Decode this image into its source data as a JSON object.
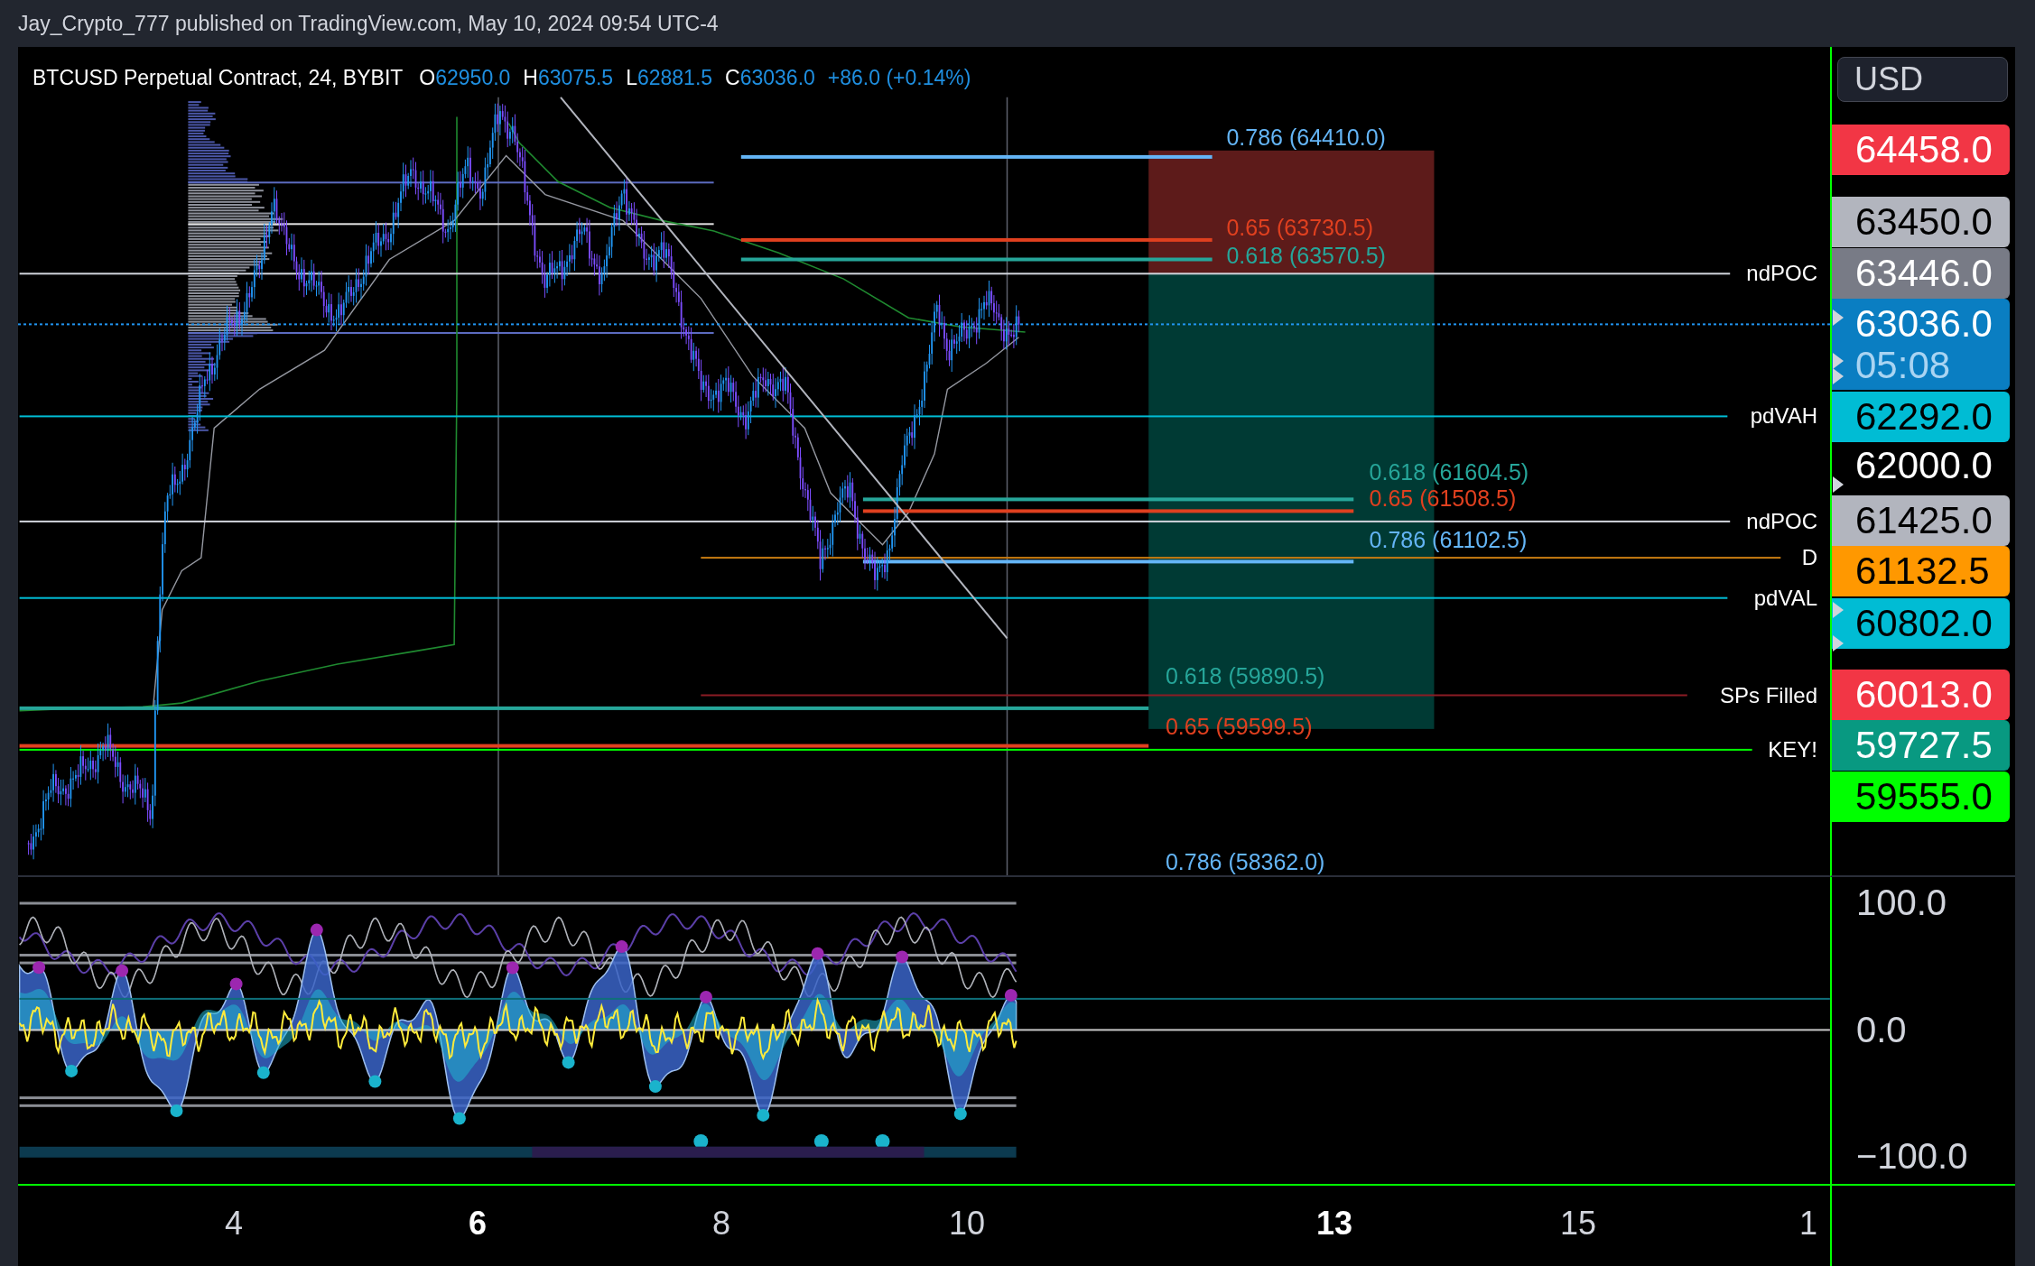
{
  "header": {
    "text": "Jay_Crypto_777 published on TradingView.com, May 10, 2024 09:54 UTC-4"
  },
  "legend": {
    "symbol": "BTCUSD Perpetual Contract, 24, BYBIT",
    "ohlc": [
      {
        "label": "O",
        "value": "62950.0"
      },
      {
        "label": "H",
        "value": "63075.5"
      },
      {
        "label": "L",
        "value": "62881.5"
      },
      {
        "label": "C",
        "value": "63036.0"
      }
    ],
    "change": "+86.0 (+0.14%)"
  },
  "levels": [
    {
      "label": "ndPOC",
      "color": "#d1d4dc"
    },
    {
      "label": "pdVAH",
      "color": "#00bcd4"
    },
    {
      "label": "ndPOC",
      "color": "#d1d4dc"
    },
    {
      "label": "D",
      "color": "#c77c12"
    },
    {
      "label": "pdVAL",
      "color": "#00bcd4"
    },
    {
      "label": "SPs Filled",
      "color": "#8b1c24"
    },
    {
      "label": "KEY!",
      "color": "#00ff00"
    }
  ],
  "fib_levels": [
    {
      "label": "0.786 (64410.0)",
      "color": "#64b5f6"
    },
    {
      "label": "0.65 (63730.5)",
      "color": "#e0401f"
    },
    {
      "label": "0.618 (63570.5)",
      "color": "#26a69a"
    },
    {
      "label": "0.618 (61604.5)",
      "color": "#26a69a"
    },
    {
      "label": "0.65 (61508.5)",
      "color": "#e0401f"
    },
    {
      "label": "0.786 (61102.5)",
      "color": "#64b5f6"
    },
    {
      "label": "0.618 (59890.5)",
      "color": "#26a69a"
    },
    {
      "label": "0.65 (59599.5)",
      "color": "#e0401f"
    },
    {
      "label": "0.786 (58362.0)",
      "color": "#64b5f6"
    }
  ],
  "price_axis": {
    "currency_button": "USD",
    "labels": [
      {
        "kind": "tag",
        "text": "64458.0",
        "color": "#f23645"
      },
      {
        "kind": "tag",
        "text": "63450.0",
        "color": "#b2b5be"
      },
      {
        "kind": "tag",
        "text": "63446.0",
        "color": "#787b86"
      },
      {
        "kind": "tag",
        "text": "63036.0",
        "countdown": "05:08",
        "color": "#0a7ec2"
      },
      {
        "kind": "tag",
        "text": "62292.0",
        "color": "#00bcd4"
      },
      {
        "kind": "tick",
        "text": "62000.0"
      },
      {
        "kind": "tag",
        "text": "61425.0",
        "color": "#b2b5be"
      },
      {
        "kind": "tag",
        "text": "61132.5",
        "color": "#ff9800"
      },
      {
        "kind": "tag",
        "text": "60802.0",
        "color": "#00bcd4"
      },
      {
        "kind": "tag",
        "text": "60013.0",
        "color": "#f23645"
      },
      {
        "kind": "tag",
        "text": "59727.5",
        "color": "#089981"
      },
      {
        "kind": "tag",
        "text": "59555.0",
        "color": "#00ff00"
      }
    ]
  },
  "oscillator_axis": [
    "100.0",
    "0.0",
    "−100.0"
  ],
  "time_axis": [
    {
      "label": "4",
      "bold": false
    },
    {
      "label": "6",
      "bold": true
    },
    {
      "label": "8",
      "bold": false
    },
    {
      "label": "10",
      "bold": false
    },
    {
      "label": "13",
      "bold": true
    },
    {
      "label": "15",
      "bold": false
    },
    {
      "label": "1",
      "bold": false
    }
  ]
}
